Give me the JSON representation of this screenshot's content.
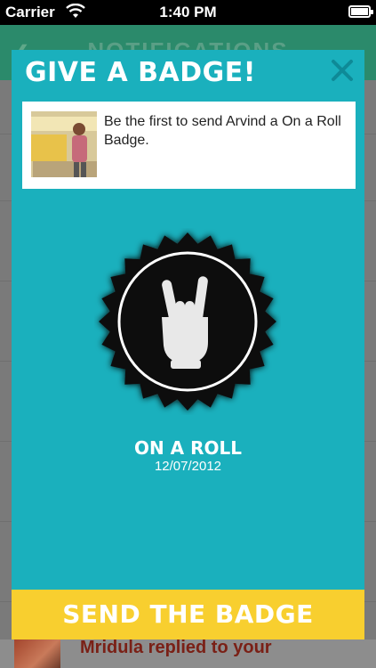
{
  "status_bar": {
    "carrier": "Carrier",
    "time": "1:40 PM",
    "wifi_icon": "wifi-icon",
    "battery_icon": "battery-icon",
    "battery_level": 1.0
  },
  "background": {
    "nav_title": "NOTIFICATIONS",
    "back_icon": "chevron-left-icon",
    "visible_row_text": "Mridula replied to your",
    "nav_color": "#2b8a6b"
  },
  "modal": {
    "title": "GIVE A BADGE!",
    "close_icon": "close-icon",
    "message": "Be the first to send Arvind a On a Roll Badge.",
    "badge": {
      "icon": "rock-hand-icon",
      "name": "ON A ROLL",
      "date": "12/07/2012"
    },
    "send_label": "SEND THE BADGE",
    "colors": {
      "background": "#1ab0bd",
      "button": "#f8cf2f",
      "badge": "#111111"
    }
  }
}
